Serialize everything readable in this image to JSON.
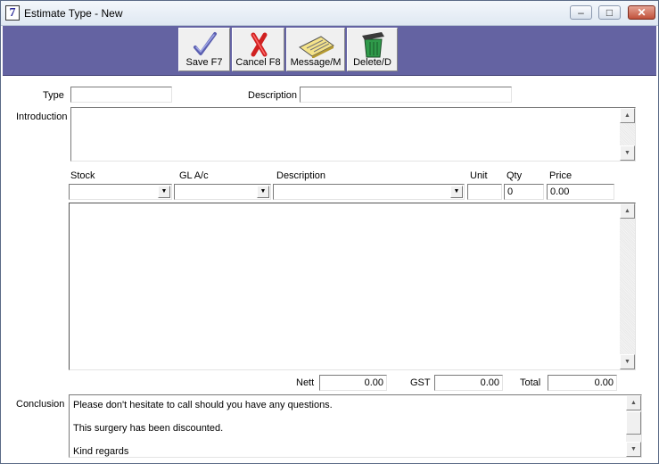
{
  "window": {
    "title": "Estimate Type - New",
    "app_icon": "7",
    "minimize_glyph": "–",
    "maximize_glyph": "□",
    "close_glyph": "✕"
  },
  "toolbar": {
    "save_label": "Save F7",
    "cancel_label": "Cancel F8",
    "message_label": "Message/M",
    "delete_label": "Delete/D",
    "save_icon": "checkmark-icon",
    "cancel_icon": "red-x-icon",
    "message_icon": "notepad-icon",
    "delete_icon": "trash-bin-icon",
    "bg_color": "#6463a2"
  },
  "form": {
    "type_label": "Type",
    "type_value": "",
    "description_label": "Description",
    "description_value": "",
    "introduction_label": "Introduction",
    "introduction_value": ""
  },
  "line_entry": {
    "headers": {
      "stock": "Stock",
      "gl": "GL A/c",
      "description": "Description",
      "unit": "Unit",
      "qty": "Qty",
      "price": "Price"
    },
    "values": {
      "stock": "",
      "gl": "",
      "description": "",
      "unit": "",
      "qty": "0",
      "price": "0.00"
    }
  },
  "totals": {
    "nett_label": "Nett",
    "nett_value": "0.00",
    "gst_label": "GST",
    "gst_value": "0.00",
    "total_label": "Total",
    "total_value": "0.00"
  },
  "conclusion": {
    "label": "Conclusion",
    "lines": [
      "Please don't hesitate to call should you have any questions.",
      "This surgery has been discounted.",
      "Kind regards"
    ]
  }
}
